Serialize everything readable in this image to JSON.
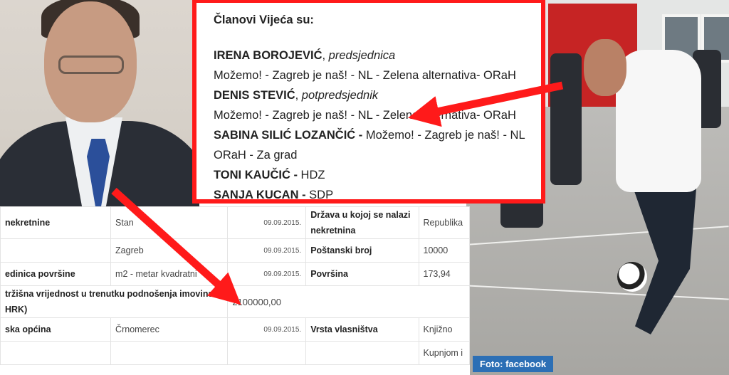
{
  "members_card": {
    "heading": "Članovi Vijeća su:",
    "members": [
      {
        "name": "IRENA BOROJEVIĆ",
        "sep": ", ",
        "role": "predsjednica",
        "line2": "Možemo! - Zagreb je naš! - NL - Zelena alternativa- ORaH"
      },
      {
        "name": "DENIS STEVIĆ",
        "sep": ", ",
        "role": "potpredsjednik",
        "line2": "Možemo! - Zagreb je naš! - NL - Zelena alternativa- ORaH"
      },
      {
        "name": "SABINA SILIĆ LOZANČIĆ -",
        "sep": " ",
        "party": "Možemo! - Zagreb je naš! - NL",
        "line2": "ORaH - Za grad"
      },
      {
        "name": "TONI KAUČIĆ -",
        "sep": " ",
        "party": "HDZ"
      },
      {
        "name": "SANJA KUCAN -",
        "sep": " ",
        "party": "SDP"
      }
    ]
  },
  "asset_table": {
    "rows": [
      {
        "label": "nekretnine",
        "value": "Stan",
        "date": "09.09.2015.",
        "label2": "Država u kojoj se nalazi nekretnina",
        "value2": "Republika"
      },
      {
        "label": "",
        "value": "Zagreb",
        "date": "09.09.2015.",
        "label2": "Poštanski broj",
        "value2": "10000"
      },
      {
        "label": "edinica površine",
        "value": "m2 - metar kvadratni",
        "date": "09.09.2015.",
        "label2": "Površina",
        "value2": "173,94"
      },
      {
        "label": "tržišna vrijednost u trenutku podnošenja imovinske",
        "label_line2": "HRK)",
        "value": "2100000,00"
      },
      {
        "label": "ska općina",
        "value": "Črnomerec",
        "date": "09.09.2015.",
        "label2": "Vrsta vlasništva",
        "value2": "Knjižno"
      },
      {
        "label": "",
        "value": "",
        "date": "",
        "label2": "",
        "value2": "Kupnjom i"
      }
    ]
  },
  "photo_caption": "Foto: facebook",
  "colors": {
    "frame": "#ff1a1a",
    "caption_bg": "#2c6fb5"
  }
}
